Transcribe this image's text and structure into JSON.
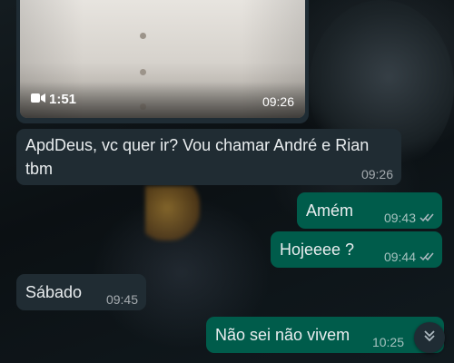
{
  "colors": {
    "incoming_bubble": "#202c33",
    "outgoing_bubble": "#005c4b",
    "text": "#e9edef",
    "meta_text": "#8696a0"
  },
  "video_message": {
    "duration": "1:51",
    "time": "09:26",
    "icon": "video-camera-icon"
  },
  "messages": [
    {
      "direction": "incoming",
      "text": "ApdDeus,  vc quer ir? Vou chamar André e Rian tbm",
      "time": "09:26"
    },
    {
      "direction": "outgoing",
      "text": "Amém",
      "time": "09:43",
      "status_icon": "double-check-icon"
    },
    {
      "direction": "outgoing",
      "text": "Hojeeee ?",
      "time": "09:44",
      "status_icon": "double-check-icon"
    },
    {
      "direction": "incoming",
      "text": "Sábado",
      "time": "09:45"
    },
    {
      "direction": "outgoing",
      "text": "Não sei não vivem",
      "time": "10:25"
    }
  ],
  "scroll_button": {
    "icon": "double-chevron-down-icon"
  }
}
